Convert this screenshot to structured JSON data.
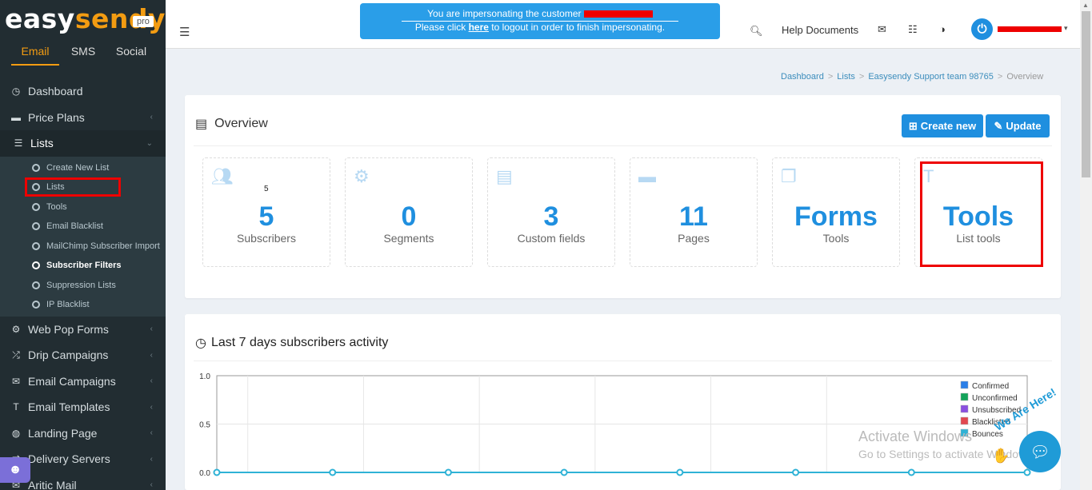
{
  "sidebar": {
    "logo_main": "easy",
    "logo_accent": "sendy",
    "logo_badge": "pro",
    "channels": [
      "Email",
      "SMS",
      "Social"
    ],
    "items": [
      {
        "label": "Dashboard",
        "icon": "dashboard-icon"
      },
      {
        "label": "Price Plans",
        "icon": "credit-card-icon"
      },
      {
        "label": "Lists",
        "icon": "list-icon"
      },
      {
        "label": "Web Pop Forms",
        "icon": "gear-icon"
      },
      {
        "label": "Drip Campaigns",
        "icon": "shuffle-icon"
      },
      {
        "label": "Email Campaigns",
        "icon": "envelope-icon"
      },
      {
        "label": "Email Templates",
        "icon": "text-icon"
      },
      {
        "label": "Landing Page",
        "icon": "globe-icon"
      },
      {
        "label": "Delivery Servers",
        "icon": "exchange-icon"
      },
      {
        "label": "Aritic Mail",
        "icon": "mail-icon"
      }
    ],
    "lists_sub": [
      "Create New List",
      "Lists",
      "Tools",
      "Email Blacklist",
      "MailChimp Subscriber Import",
      "Subscriber Filters",
      "Suppression Lists",
      "IP Blacklist"
    ]
  },
  "topbar": {
    "impersonate_line1": "You are impersonating the customer",
    "impersonate_line2_pre": "Please click",
    "impersonate_here": "here",
    "impersonate_line2_post": "to logout in order to finish impersonating.",
    "help_documents": "Help Documents"
  },
  "breadcrumb": [
    "Dashboard",
    "Lists",
    "Easysendy Support team 98765",
    "Overview"
  ],
  "overview": {
    "title": "Overview",
    "create_new": "Create new",
    "update": "Update",
    "stats": [
      {
        "value": "5",
        "label": "Subscribers",
        "extra": "5",
        "icon": "users-icon"
      },
      {
        "value": "0",
        "label": "Segments",
        "icon": "gear-icon"
      },
      {
        "value": "3",
        "label": "Custom fields",
        "icon": "document-icon"
      },
      {
        "value": "11",
        "label": "Pages",
        "icon": "folder-icon"
      },
      {
        "value": "Forms",
        "label": "Tools",
        "icon": "copy-icon"
      },
      {
        "value": "Tools",
        "label": "List tools",
        "icon": "hammer-icon"
      }
    ]
  },
  "activity": {
    "title": "Last 7 days subscribers activity"
  },
  "chart_data": {
    "type": "line",
    "title": "Last 7 days subscribers activity",
    "ylim": [
      0,
      1.0
    ],
    "yticks": [
      "1.0",
      "0.5",
      "0.0"
    ],
    "series": [
      {
        "name": "Confirmed",
        "color": "#2a7fe8",
        "values": [
          0,
          0,
          0,
          0,
          0,
          0,
          0,
          0
        ]
      },
      {
        "name": "Unconfirmed",
        "color": "#13a35a",
        "values": [
          0,
          0,
          0,
          0,
          0,
          0,
          0,
          0
        ]
      },
      {
        "name": "Unsubscribed",
        "color": "#8a4fe0",
        "values": [
          0,
          0,
          0,
          0,
          0,
          0,
          0,
          0
        ]
      },
      {
        "name": "Blacklisted",
        "color": "#e2474f",
        "values": [
          0,
          0,
          0,
          0,
          0,
          0,
          0,
          0
        ]
      },
      {
        "name": "Bounces",
        "color": "#2fb2d6",
        "values": [
          0,
          0,
          0,
          0,
          0,
          0,
          0,
          0
        ]
      }
    ],
    "grid": true,
    "legend_position": "top-right"
  },
  "watermark": {
    "line1": "Activate Windows",
    "line2": "Go to Settings to activate Windows."
  },
  "chat": {
    "label": "We Are Here!"
  }
}
